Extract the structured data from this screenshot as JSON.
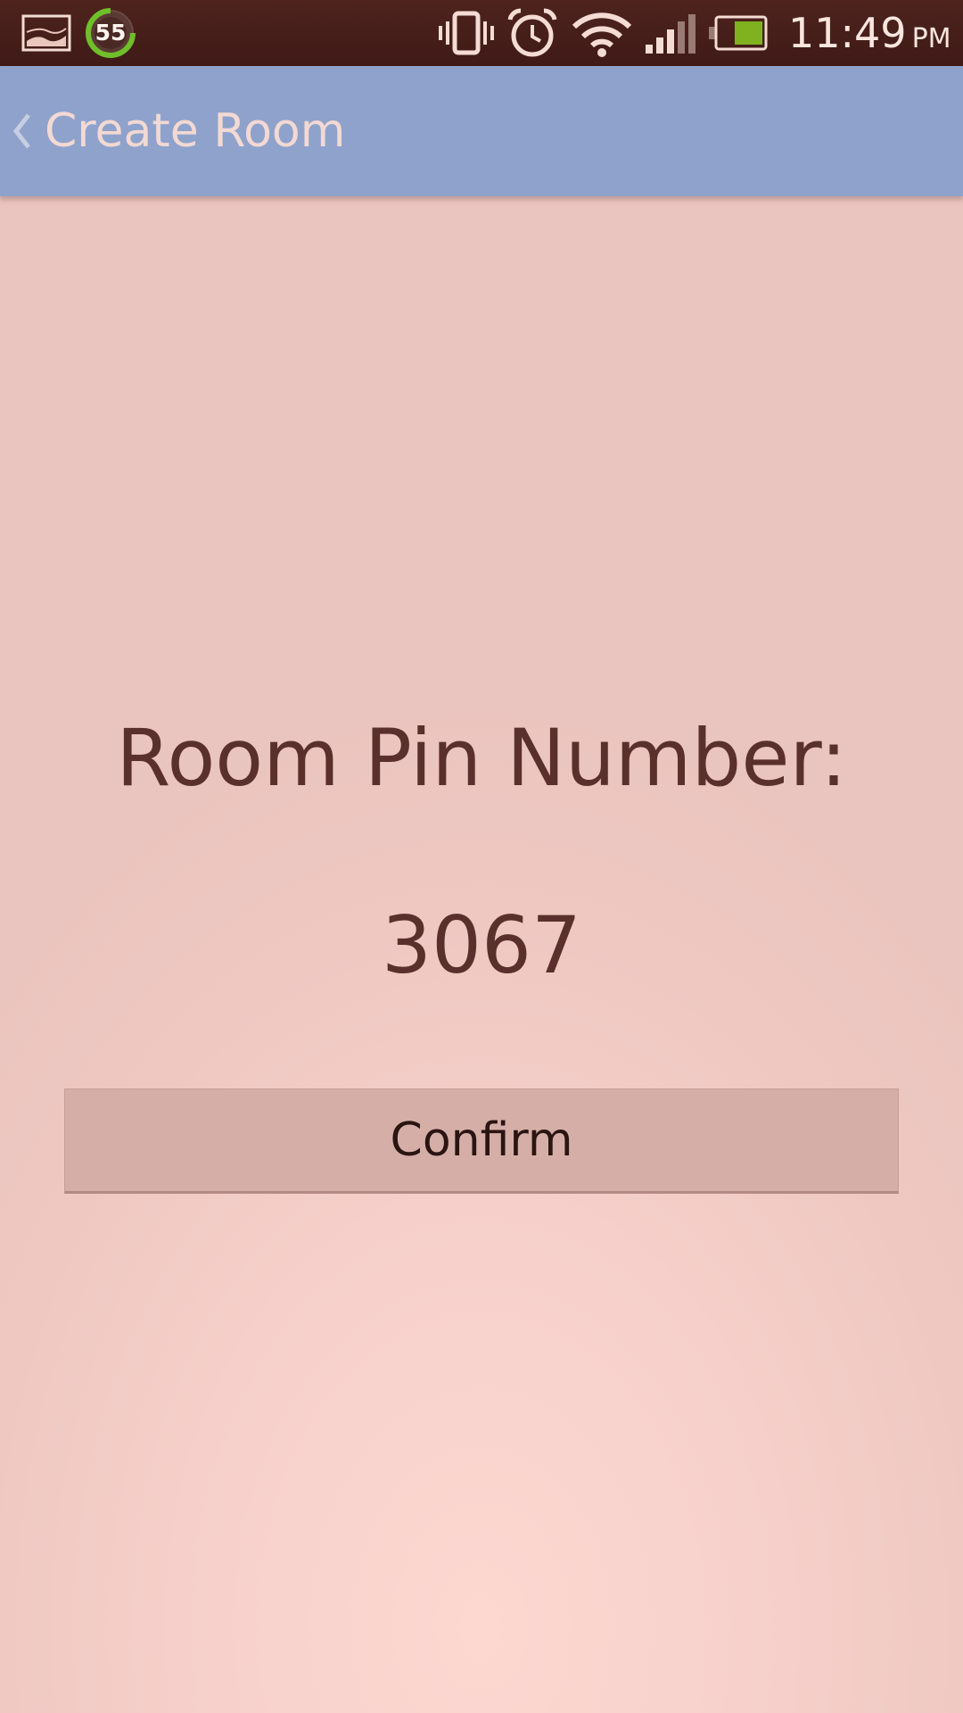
{
  "status_bar": {
    "notification_badge": "55",
    "time": "11:49",
    "ampm": "PM",
    "icons": [
      "gallery-icon",
      "progress-badge-icon",
      "vibrate-icon",
      "alarm-icon",
      "wifi-icon",
      "signal-icon",
      "battery-icon"
    ],
    "battery_color": "#7fb21e",
    "badge_ring_color": "#6fbf2a"
  },
  "action_bar": {
    "title": "Create Room",
    "background_color": "#8fa2cc"
  },
  "main": {
    "pin_label": "Room Pin Number:",
    "pin_value": "3067",
    "confirm_label": "Confirm",
    "text_color": "#5a302c"
  }
}
